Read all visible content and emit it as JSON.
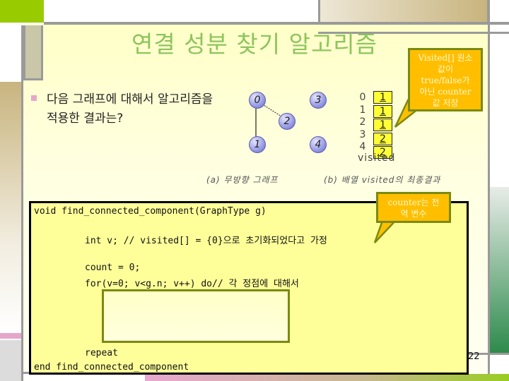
{
  "slide": {
    "title": "연결 성분 찾기 알고리즘",
    "bullet": {
      "line1": "다음 그래프에 대해서 알고리즘을",
      "line2": "적용한 결과는?"
    },
    "graph": {
      "nodes": [
        "0",
        "3",
        "2",
        "1",
        "4"
      ],
      "edges": [
        [
          "0",
          "1"
        ],
        [
          "0",
          "2"
        ]
      ],
      "caption": "(a) 무방향 그래프"
    },
    "visited_array": {
      "indices": [
        "0",
        "1",
        "2",
        "3",
        "4"
      ],
      "values": [
        "1",
        "1",
        "1",
        "2",
        "2"
      ],
      "label": "visited",
      "caption": "(b) 배열 visited의 최종결과"
    },
    "callouts": {
      "visited_note": [
        "Visited[] 원소",
        "값이",
        "true/false가",
        "아닌 counter",
        "값 저장"
      ],
      "counter_note": [
        "counter는 전",
        "역 변수"
      ]
    },
    "code": {
      "signature": "void find_connected_component(GraphType g)",
      "line_init": "int v; // visited[] = {0}으로 초기화되었다고 가정",
      "line_count": "count = 0;",
      "line_for": "for(v=0; v<g.n; v++) do// 각 정점에 대해서",
      "line_repeat": "repeat",
      "line_end": "end find_connected_component"
    },
    "page_number": "22",
    "colors": {
      "title": "#8dc45e",
      "callout_fill": "#ffbf00",
      "callout_border": "#7a8a10",
      "code_bg": "#ffff9a",
      "cell_fill": "#ffff33"
    }
  }
}
